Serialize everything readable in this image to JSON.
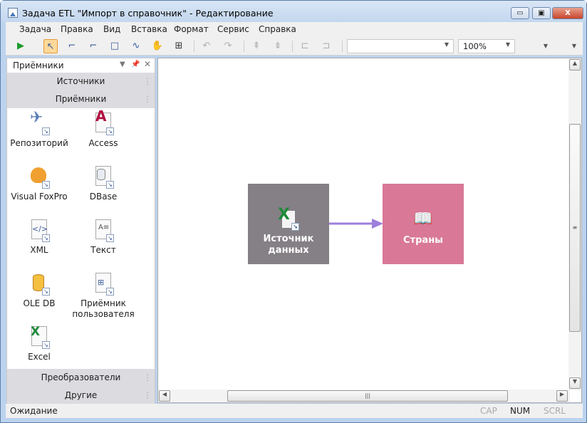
{
  "window": {
    "title": "Задача ETL \"Импорт в справочник\" - Редактирование",
    "min": "▭",
    "max": "▣",
    "close": "X"
  },
  "menu": [
    "Задача",
    "Правка",
    "Вид",
    "Вставка",
    "Формат",
    "Сервис",
    "Справка"
  ],
  "toolbar": {
    "font_combo": "",
    "zoom": "100%"
  },
  "panel": {
    "title": "Приёмники",
    "groups": {
      "sources": "Источники",
      "receivers": "Приёмники",
      "transformers": "Преобразователи",
      "other": "Другие"
    },
    "items": [
      "Репозиторий",
      "Access",
      "Visual FoxPro",
      "DBase",
      "XML",
      "Текст",
      "OLE DB",
      "Приёмник пользователя",
      "Excel"
    ]
  },
  "canvas": {
    "nodes": {
      "source": "Источник данных",
      "target": "Страны"
    },
    "colors": {
      "source": "#858085",
      "target": "#d97897",
      "arrow": "#9d7fdc"
    }
  },
  "status": {
    "text": "Ожидание",
    "cap": "CAP",
    "num": "NUM",
    "scrl": "SCRL"
  }
}
